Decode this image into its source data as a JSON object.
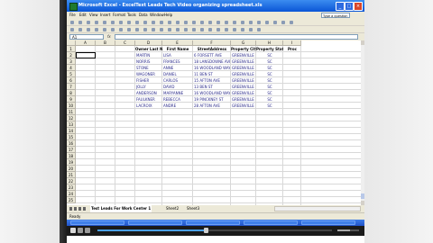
{
  "window": {
    "title": "Microsoft Excel - ExcelText Leads Tech Video organizing spreadsheet.xls"
  },
  "menu": [
    "File",
    "Edit",
    "View",
    "Insert",
    "Format",
    "Tools",
    "Data",
    "Window",
    "Help"
  ],
  "help_search": "Type a question",
  "formula_bar": {
    "name_box": "A1",
    "fx": "fx",
    "value": ""
  },
  "columns": [
    "A",
    "B",
    "C",
    "D",
    "E",
    "F",
    "G",
    "H",
    "I"
  ],
  "rows": [
    "1",
    "2",
    "3",
    "4",
    "5",
    "6",
    "7",
    "8",
    "9",
    "10",
    "11",
    "12",
    "13",
    "14",
    "15",
    "16",
    "17",
    "18",
    "19",
    "20",
    "21",
    "22",
    "23",
    "24",
    "25"
  ],
  "headers": [
    "Owner Last Name",
    "First Name",
    "StreetAddress",
    "Property City",
    "Property State",
    "Proc"
  ],
  "data_rows": [
    [
      "MARTIN",
      "LISA",
      "6 FORSETT AVE",
      "GREENVILLE",
      "SC"
    ],
    [
      "NORRIS",
      "FRANCES",
      "18 LANSDOWNE AVE",
      "GREENVILLE",
      "SC"
    ],
    [
      "STONE",
      "ANNE",
      "16 WOODLAND WAY",
      "GREENVILLE",
      "SC"
    ],
    [
      "WAGONER",
      "DANIEL",
      "11 BEN ST",
      "GREENVILLE",
      "SC"
    ],
    [
      "FISHER",
      "CARLOS",
      "15 AFTON AVE",
      "GREENVILLE",
      "SC"
    ],
    [
      "JOLLY",
      "DAVID",
      "13 BEN ST",
      "GREENVILLE",
      "SC"
    ],
    [
      "ANDERSON",
      "MARYANNE",
      "16 WOODLAND WAY",
      "GREENVILLE",
      "SC"
    ],
    [
      "FAULKNER",
      "REBECCA",
      "19 PINCKNEY ST",
      "GREENVILLE",
      "SC"
    ],
    [
      "LACROIX",
      "ANDRE",
      "28 AFTON AVE",
      "GREENVILLE",
      "SC"
    ]
  ],
  "sheet_tabs": [
    "Test Leads For Work Center 1",
    "Sheet2",
    "Sheet3"
  ],
  "status": "Ready",
  "player": {
    "progress": 0.46,
    "volume": 0.6
  }
}
